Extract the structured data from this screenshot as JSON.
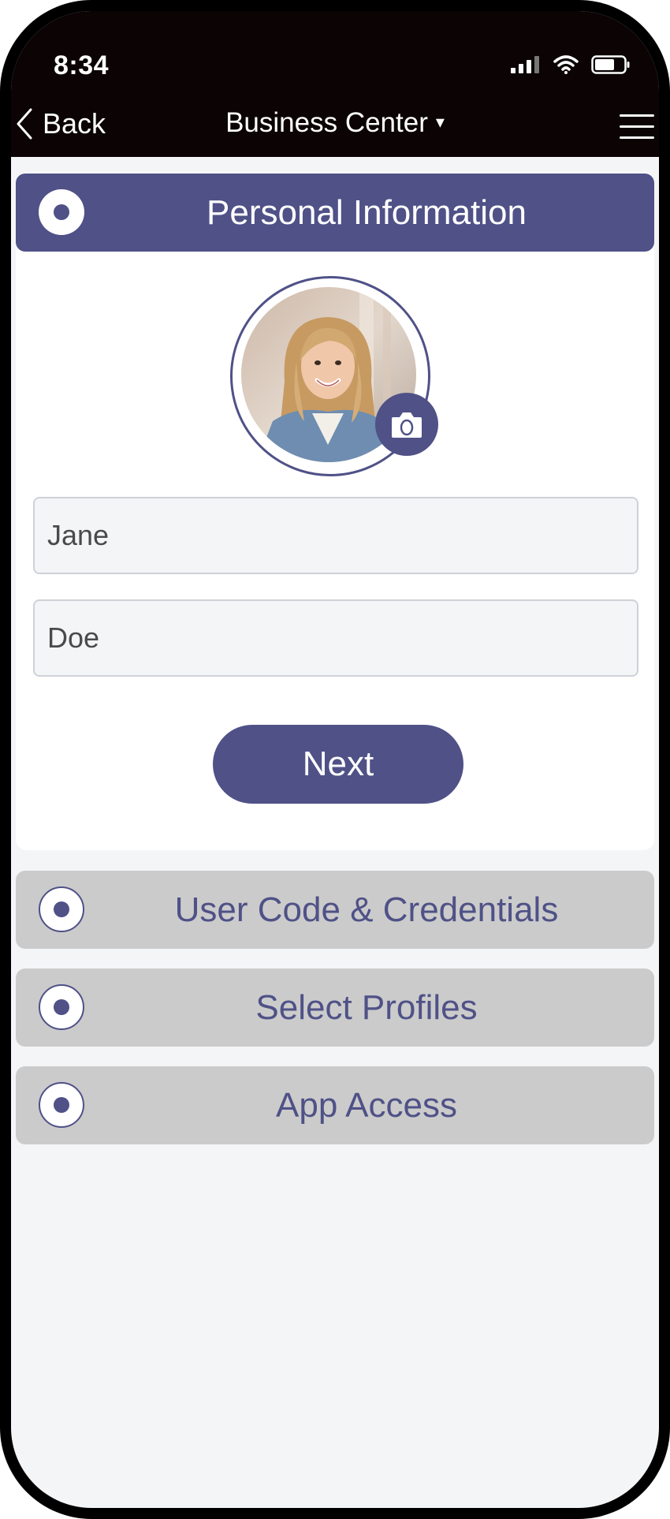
{
  "status_bar": {
    "time": "8:34",
    "icons": [
      "signal-icon",
      "wifi-icon",
      "battery-icon"
    ]
  },
  "nav": {
    "back_label": "Back",
    "title": "Business Center",
    "title_caret": "▾",
    "menu_icon": "hamburger-menu-icon"
  },
  "sections": {
    "personal": {
      "label": "Personal Information",
      "expanded": true
    },
    "credentials": {
      "label": "User Code & Credentials",
      "expanded": false
    },
    "profiles": {
      "label": "Select Profiles",
      "expanded": false
    },
    "app_access": {
      "label": "App Access",
      "expanded": false
    }
  },
  "form": {
    "first_name": "Jane",
    "last_name": "Doe",
    "next_label": "Next"
  },
  "colors": {
    "accent": "#4f5187",
    "header_bg": "#0b0304",
    "inactive_section": "#cbcbcb",
    "page_bg": "#f4f5f7"
  }
}
